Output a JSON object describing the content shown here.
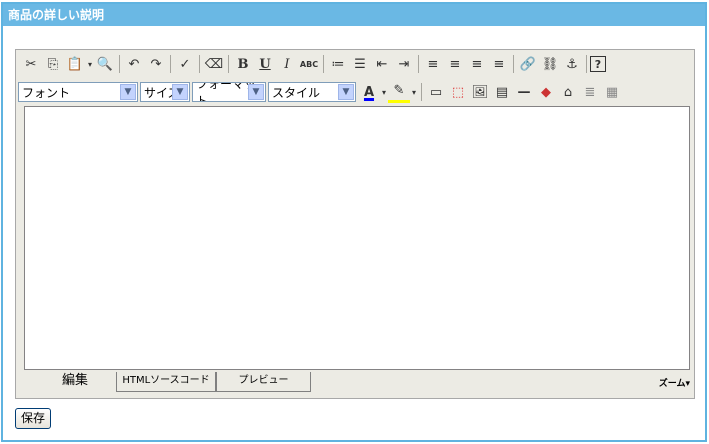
{
  "panel": {
    "title": "商品の詳しい説明"
  },
  "toolbar1": {
    "cut": "✂",
    "copy": "⎘",
    "paste": "📋",
    "find": "🔍",
    "undo": "↶",
    "redo": "↷",
    "spellcheck": "✓",
    "eraser": "⌫",
    "bold": "B",
    "underline": "U",
    "italic": "I",
    "strike": "ABC",
    "ol": "≔",
    "ul": "☰",
    "outdent": "⇤",
    "indent": "⇥",
    "align_left": "≡",
    "align_center": "≡",
    "align_right": "≡",
    "align_justify": "≡",
    "link": "🔗",
    "unlink": "⛓",
    "anchor": "⚓",
    "help": "?"
  },
  "toolbar2": {
    "font_label": "フォント",
    "size_label": "サイズ",
    "format_label": "フォーマット",
    "style_label": "スタイル",
    "font_color": "A",
    "highlight": "✎",
    "tb_icons": [
      "▭",
      "⬚",
      "🖼",
      "▤",
      "—",
      "◆",
      "⌂",
      "≣",
      "▦"
    ]
  },
  "tabs": {
    "edit": "編集",
    "html": "HTMLソースコード",
    "preview": "プレビュー"
  },
  "zoom": {
    "label": "ズーム"
  },
  "save_label": "保存",
  "colors": {
    "title_bar": "#6ab8e4",
    "panel_border": "#5fb3e0",
    "toolbar_bg": "#ecebe4"
  }
}
